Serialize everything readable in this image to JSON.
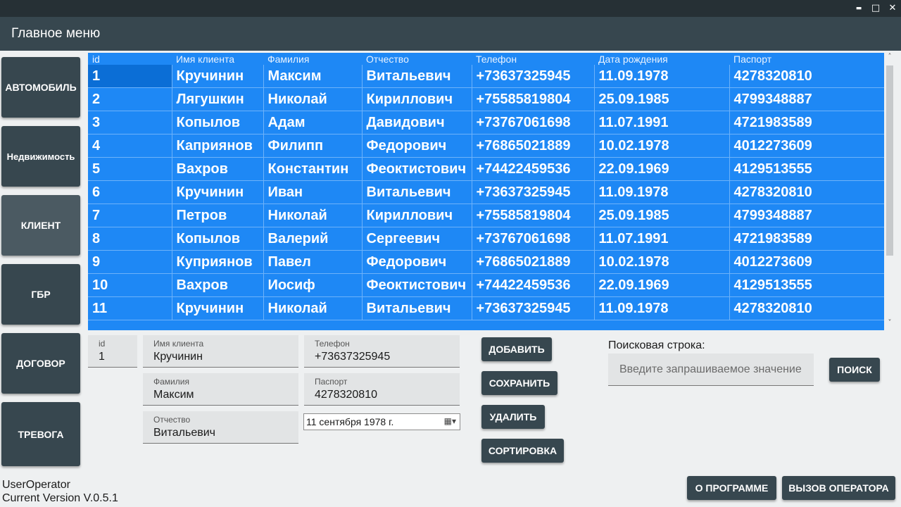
{
  "window": {
    "minimize": "▬",
    "maximize": "□",
    "close": "✕"
  },
  "header": {
    "title": "Главное меню"
  },
  "nav": [
    "АВТОМОБИЛЬ",
    "Недвижимость",
    "КЛИЕНТ",
    "ГБР",
    "ДОГОВОР",
    "ТРЕВОГА"
  ],
  "grid": {
    "columns": [
      "id",
      "Имя клиента",
      "Фамилия",
      "Отчество",
      "Телефон",
      "Дата рождения",
      "Паспорт"
    ],
    "rows": [
      [
        "1",
        "Кручинин",
        "Максим",
        "Витальевич",
        "+73637325945",
        "11.09.1978",
        "4278320810"
      ],
      [
        "2",
        "Лягушкин",
        "Николай",
        "Кириллович",
        "+75585819804",
        "25.09.1985",
        "4799348887"
      ],
      [
        "3",
        "Копылов",
        "Адам",
        "Давидович",
        "+73767061698",
        "11.07.1991",
        "4721983589"
      ],
      [
        "4",
        "Каприянов",
        "Филипп",
        "Федорович",
        "+76865021889",
        "10.02.1978",
        "4012273609"
      ],
      [
        "5",
        "Вахров",
        "Константин",
        "Феоктистович",
        "+74422459536",
        "22.09.1969",
        "4129513555"
      ],
      [
        "6",
        "Кручинин",
        "Иван",
        "Витальевич",
        "+73637325945",
        "11.09.1978",
        "4278320810"
      ],
      [
        "7",
        "Петров",
        "Николай",
        "Кириллович",
        "+75585819804",
        "25.09.1985",
        "4799348887"
      ],
      [
        "8",
        "Копылов",
        "Валерий",
        "Сергеевич",
        "+73767061698",
        "11.07.1991",
        "4721983589"
      ],
      [
        "9",
        "Куприянов",
        "Павел",
        "Федорович",
        "+76865021889",
        "10.02.1978",
        "4012273609"
      ],
      [
        "10",
        "Вахров",
        "Иосиф",
        "Феоктистович",
        "+74422459536",
        "22.09.1969",
        "4129513555"
      ],
      [
        "11",
        "Кручинин",
        "Николай",
        "Витальевич",
        "+73637325945",
        "11.09.1978",
        "4278320810"
      ]
    ],
    "scroll_up": "˄",
    "scroll_down": "˅"
  },
  "form": {
    "id": {
      "label": "id",
      "value": "1"
    },
    "first_name": {
      "label": "Имя клиента",
      "value": "Кручинин"
    },
    "last_name": {
      "label": "Фамилия",
      "value": "Максим"
    },
    "patronymic": {
      "label": "Отчество",
      "value": "Витальевич"
    },
    "phone": {
      "label": "Телефон",
      "value": "+73637325945"
    },
    "passport": {
      "label": "Паспорт",
      "value": "4278320810"
    },
    "birth_date": "11 сентября 1978 г.",
    "calendar_icon": "▦▾"
  },
  "actions": {
    "add": "ДОБАВИТЬ",
    "save": "СОХРАНИТЬ",
    "delete": "УДАЛИТЬ",
    "sort": "СОРТИРОВКА"
  },
  "search": {
    "label": "Поисковая строка:",
    "placeholder": "Введите запрашиваемое значение",
    "button": "ПОИСК"
  },
  "footer": {
    "user": "UserOperator",
    "version": "Current Version V.0.5.1",
    "about": "О ПРОГРАММЕ",
    "call_operator": "ВЫЗОВ ОПЕРАТОРА"
  },
  "colors": {
    "header": "#37474f",
    "titlebar": "#263035",
    "grid": "#1e88f5",
    "selected_cell": "#0b6ed6"
  }
}
